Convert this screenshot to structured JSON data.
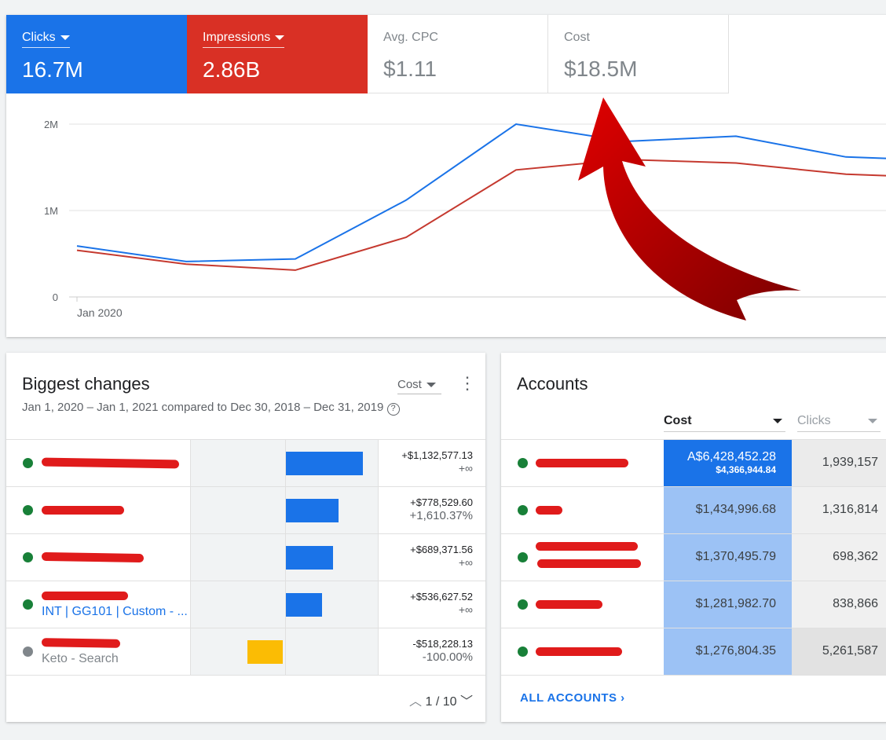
{
  "scorecards": [
    {
      "label": "Clicks",
      "value": "16.7M",
      "color": "#1a73e8"
    },
    {
      "label": "Impressions",
      "value": "2.86B",
      "color": "#d93025"
    },
    {
      "label": "Avg. CPC",
      "value": "$1.11"
    },
    {
      "label": "Cost",
      "value": "$18.5M"
    }
  ],
  "chart_data": {
    "type": "line",
    "x": [
      "Jan 2020",
      "",
      "",
      "",
      "",
      "",
      "",
      "",
      ""
    ],
    "x_tick_label": "Jan 2020",
    "yticks": [
      "0",
      "1M",
      "2M"
    ],
    "ylim": [
      0,
      2000000
    ],
    "series": [
      {
        "name": "Clicks",
        "color": "#1a73e8",
        "values": [
          590000,
          410000,
          440000,
          1120000,
          2000000,
          1800000,
          1860000,
          1620000,
          1600000
        ]
      },
      {
        "name": "Impressions",
        "color": "#c5392f",
        "values": [
          540000,
          380000,
          310000,
          690000,
          1470000,
          1590000,
          1550000,
          1420000,
          1400000
        ]
      }
    ]
  },
  "biggest_changes": {
    "title": "Biggest changes",
    "metric": "Cost",
    "date_range": "Jan 1, 2020 – Jan 1, 2021 compared to Dec 30, 2018 – Dec 31, 2019",
    "rows": [
      {
        "sub": "",
        "change": "+$1,132,577.13",
        "pct": "+∞",
        "bar": 1132577,
        "status": "active"
      },
      {
        "sub": "",
        "change": "+$778,529.60",
        "pct": "+1,610.37%",
        "bar": 778529,
        "status": "active"
      },
      {
        "sub": "",
        "change": "+$689,371.56",
        "pct": "+∞",
        "bar": 689371,
        "status": "active"
      },
      {
        "sub": "INT | GG101 | Custom - ...",
        "change": "+$536,627.52",
        "pct": "+∞",
        "bar": 536627,
        "status": "active"
      },
      {
        "sub": "Keto - Search",
        "change": "-$518,228.13",
        "pct": "-100.00%",
        "bar": -518228,
        "status": "paused"
      }
    ],
    "pagination": "1 / 10"
  },
  "accounts": {
    "title": "Accounts",
    "col_cost": "Cost",
    "col_clicks": "Clicks",
    "rows": [
      {
        "cost": "A$6,428,452.28",
        "cost2": "$4,366,944.84",
        "clicks": "1,939,157"
      },
      {
        "cost": "$1,434,996.68",
        "clicks": "1,316,814"
      },
      {
        "cost": "$1,370,495.79",
        "clicks": "698,362"
      },
      {
        "cost": "$1,281,982.70",
        "clicks": "838,866"
      },
      {
        "cost": "$1,276,804.35",
        "clicks": "5,261,587"
      }
    ],
    "all_link": "ALL ACCOUNTS"
  }
}
